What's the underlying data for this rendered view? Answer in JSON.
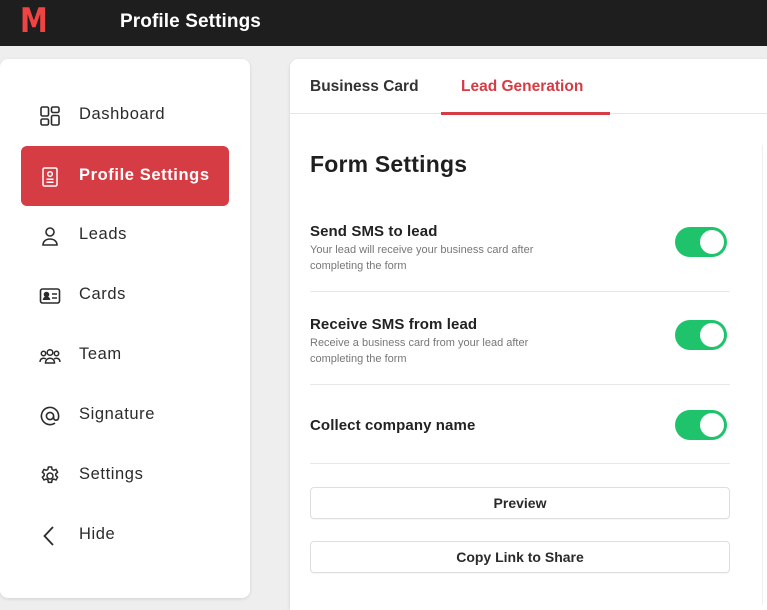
{
  "app": {
    "logo_text": "M",
    "title": "Profile Settings"
  },
  "colors": {
    "accent": "#d63c44",
    "toggle_on": "#1fc36b",
    "topbar": "#1e1e1e"
  },
  "sidebar": {
    "items": [
      {
        "label": "Dashboard",
        "icon": "dashboard-icon",
        "active": false
      },
      {
        "label": "Profile Settings",
        "icon": "profile-card-icon",
        "active": true
      },
      {
        "label": "Leads",
        "icon": "person-icon",
        "active": false
      },
      {
        "label": "Cards",
        "icon": "id-card-icon",
        "active": false
      },
      {
        "label": "Team",
        "icon": "team-icon",
        "active": false
      },
      {
        "label": "Signature",
        "icon": "at-sign-icon",
        "active": false
      },
      {
        "label": "Settings",
        "icon": "gear-icon",
        "active": false
      },
      {
        "label": "Hide",
        "icon": "chevron-left-icon",
        "active": false
      }
    ]
  },
  "tabs": [
    {
      "label": "Business Card",
      "active": false
    },
    {
      "label": "Lead Generation",
      "active": true
    }
  ],
  "form": {
    "title": "Form Settings",
    "settings": [
      {
        "title": "Send SMS to lead",
        "description": "Your lead will receive your business card after completing the form",
        "enabled": true
      },
      {
        "title": "Receive SMS from lead",
        "description": "Receive a business card from your lead after completing the form",
        "enabled": true
      },
      {
        "title": "Collect company name",
        "description": "",
        "enabled": true
      }
    ],
    "preview_label": "Preview",
    "copy_link_label": "Copy Link to Share"
  }
}
